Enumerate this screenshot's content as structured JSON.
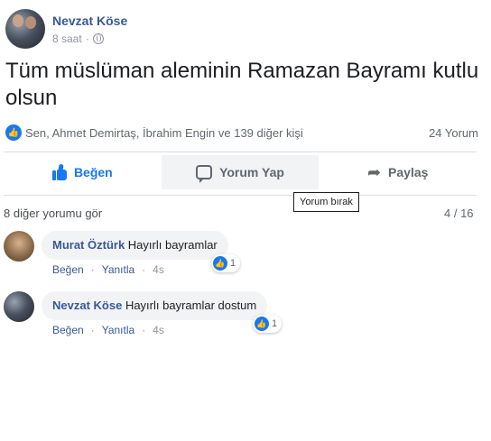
{
  "post": {
    "author": "Nevzat Köse",
    "time": "8 saat",
    "separator": "·",
    "text": "Tüm müslüman aleminin Ramazan Bayramı kutlu olsun"
  },
  "reactions": {
    "summary": "Sen, Ahmet Demirtaş, İbrahim Engin ve 139 diğer kişi",
    "comment_count": "24 Yorum"
  },
  "actions": {
    "like": "Beğen",
    "comment": "Yorum Yap",
    "share": "Paylaş"
  },
  "tooltip": "Yorum bırak",
  "comments_section": {
    "more_comments": "8 diğer yorumu gör",
    "page": "4 / 16",
    "comments": [
      {
        "author": "Murat Öztürk",
        "text": "Hayırlı bayramlar",
        "like_label": "Beğen",
        "reply_label": "Yanıtla",
        "time": "4s",
        "separator": "·",
        "reaction_count": "1"
      },
      {
        "author": "Nevzat Köse",
        "text": "Hayırlı bayramlar dostum",
        "like_label": "Beğen",
        "reply_label": "Yanıtla",
        "time": "4s",
        "separator": "·",
        "reaction_count": "1"
      }
    ]
  },
  "colors": {
    "accent": "#1877f2",
    "name_link": "#385898",
    "muted": "#606770",
    "bubble_bg": "#f2f3f5"
  },
  "icons": [
    "globe-icon",
    "like-icon",
    "comment-icon",
    "share-icon"
  ]
}
